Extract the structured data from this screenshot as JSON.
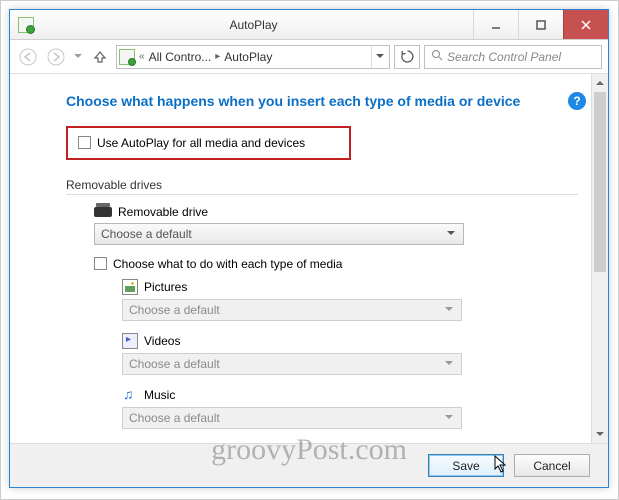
{
  "window": {
    "title": "AutoPlay"
  },
  "nav": {
    "back_enabled": false,
    "forward_enabled": false,
    "up_enabled": true,
    "crumb1": "All Contro...",
    "crumb2": "AutoPlay",
    "search_placeholder": "Search Control Panel"
  },
  "page": {
    "title": "Choose what happens when you insert each type of media or device",
    "help": "?"
  },
  "global_checkbox": {
    "checked": false,
    "label": "Use AutoPlay for all media and devices"
  },
  "sections": {
    "removable": {
      "header": "Removable drives",
      "drive_label": "Removable drive",
      "default_text": "Choose a default",
      "each_type_checked": false,
      "each_type_label": "Choose what to do with each type of media"
    },
    "media": {
      "pictures": {
        "label": "Pictures",
        "value": "Choose a default"
      },
      "videos": {
        "label": "Videos",
        "value": "Choose a default"
      },
      "music": {
        "label": "Music",
        "value": "Choose a default"
      }
    }
  },
  "buttons": {
    "save": "Save",
    "cancel": "Cancel"
  },
  "watermark": "groovyPost.com"
}
